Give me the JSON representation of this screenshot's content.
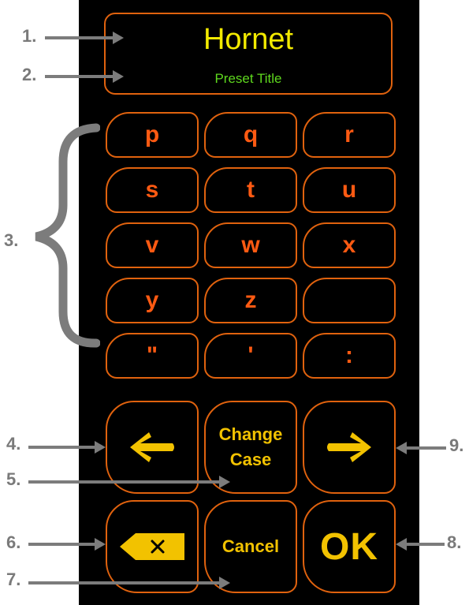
{
  "header": {
    "title": "Hornet",
    "subtitle": "Preset Title"
  },
  "keyboard": {
    "keys": [
      "p",
      "q",
      "r",
      "s",
      "t",
      "u",
      "v",
      "w",
      "x",
      "y",
      "z",
      "",
      "\"",
      "'",
      ":"
    ]
  },
  "controls": {
    "change_case_line1": "Change",
    "change_case_line2": "Case",
    "cancel_label": "Cancel",
    "ok_label": "OK",
    "left_icon": "arrow-left-icon",
    "right_icon": "arrow-right-icon",
    "backspace_icon": "backspace-icon"
  },
  "callouts": [
    "1.",
    "2.",
    "3.",
    "4.",
    "5.",
    "6.",
    "7.",
    "8.",
    "9."
  ],
  "colors": {
    "background": "#000000",
    "border": "#e0620e",
    "letter": "#ff5a12",
    "title": "#f2ea00",
    "subtitle": "#5ed81e",
    "icon": "#f2c200",
    "annotation": "#7a7a7a"
  }
}
